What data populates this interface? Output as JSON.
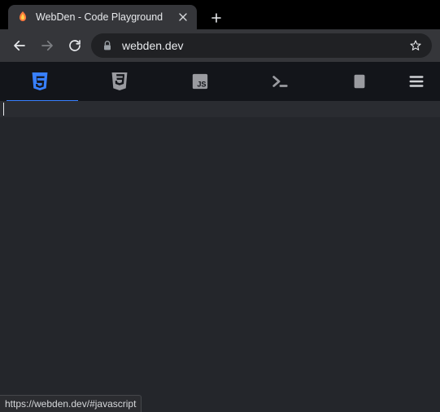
{
  "browser": {
    "tab_title": "WebDen - Code Playground",
    "url": "webden.dev",
    "status_url": "https://webden.dev/#javascript"
  },
  "app_tabs": {
    "html_icon": "html5-icon",
    "css_icon": "css3-icon",
    "js_icon": "js-icon",
    "console_icon": "console-icon",
    "preview_icon": "tablet-icon",
    "active": "html"
  },
  "colors": {
    "accent": "#3880ff",
    "chrome": "#35363a",
    "page_bg": "#24262b"
  }
}
